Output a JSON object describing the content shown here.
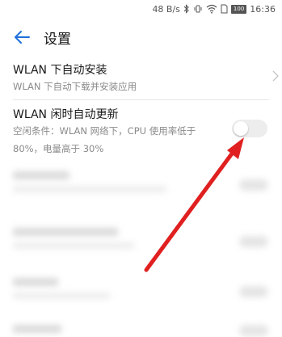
{
  "status_bar": {
    "speed": "48 B/s",
    "battery": "100",
    "time": "16:36",
    "icons": [
      "bluetooth-icon",
      "vibrate-icon",
      "wifi-icon",
      "sim-icon"
    ]
  },
  "header": {
    "title": "设置",
    "back_icon": "back-arrow-icon"
  },
  "settings": [
    {
      "title": "WLAN 下自动安装",
      "subtitle": "WLAN 下自动下载并安装应用",
      "control": "chevron-right-icon"
    },
    {
      "title": "WLAN 闲时自动更新",
      "subtitle_line1": "空闲条件：WLAN 网络下，CPU 使用率低于",
      "subtitle_line2": "80%，电量高于 30%",
      "control": "toggle",
      "toggle_on": false
    }
  ],
  "colors": {
    "accent": "#1e6fd9",
    "annotation_arrow": "#e02020",
    "toggle_off": "#ededed"
  }
}
